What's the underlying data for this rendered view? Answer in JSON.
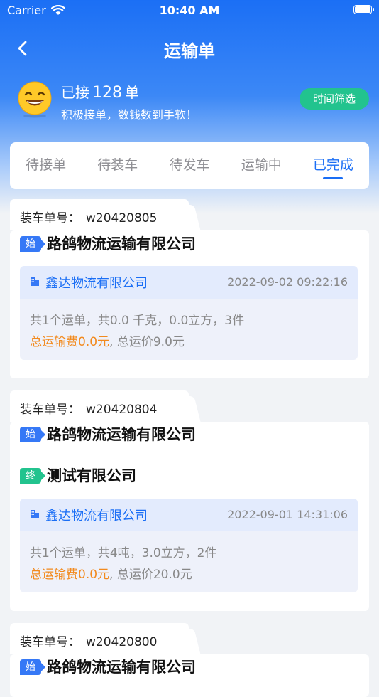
{
  "status_bar": {
    "carrier": "Carrier",
    "time": "10:40 AM"
  },
  "nav": {
    "title": "运输单"
  },
  "summary": {
    "prefix": "已接",
    "count": "128",
    "unit": "单",
    "slogan": "积极接单，数钱数到手软！",
    "filter_label": "时间筛选"
  },
  "tabs": [
    {
      "label": "待接单"
    },
    {
      "label": "待装车"
    },
    {
      "label": "待发车"
    },
    {
      "label": "运输中"
    },
    {
      "label": "已完成",
      "active": true
    }
  ],
  "order_no_label": "装车单号：",
  "badges": {
    "start": "始",
    "end": "终"
  },
  "orders": [
    {
      "order_no": "w20420805",
      "start": "路鸽物流运输有限公司",
      "company": "鑫达物流有限公司",
      "time": "2022-09-02 09:22:16",
      "stats": "共1个运单，共0.0 千克，0.0立方，3件",
      "fee": "总运输费0.0元",
      "total": ", 总运价9.0元"
    },
    {
      "order_no": "w20420804",
      "start": "路鸽物流运输有限公司",
      "end": "测试有限公司",
      "company": "鑫达物流有限公司",
      "time": "2022-09-01 14:31:06",
      "stats": "共1个运单，共4吨，3.0立方，2件",
      "fee": "总运输费0.0元",
      "total": ", 总运价20.0元"
    },
    {
      "order_no": "w20420800",
      "start": "路鸽物流运输有限公司"
    }
  ],
  "colors": {
    "primary": "#1a6ef5",
    "green": "#22c38e",
    "orange": "#f28a1e",
    "background": "#f1f3f6"
  }
}
